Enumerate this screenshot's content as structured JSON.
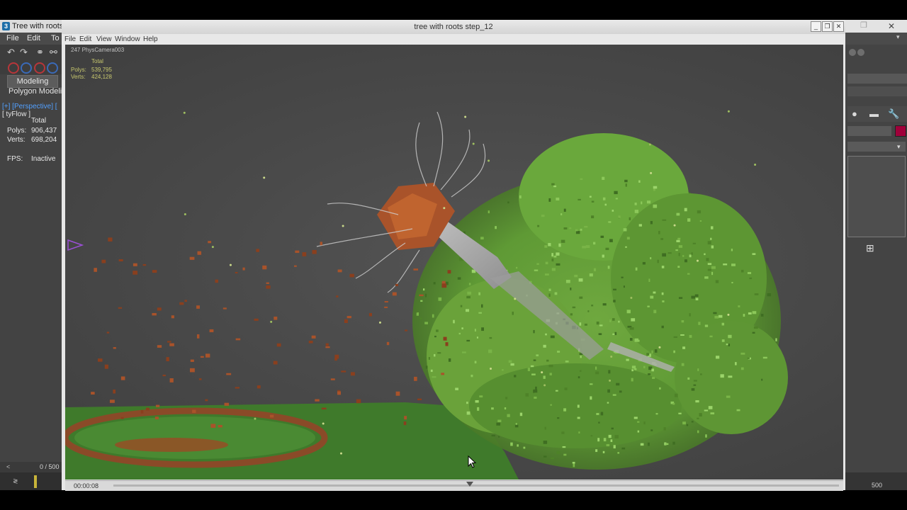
{
  "bg_window": {
    "title": "Tree with roots",
    "menu": [
      "File",
      "Edit",
      "To"
    ],
    "ribbon_tab": "Modeling",
    "ribbon_sub": "Polygon Modelin",
    "viewport_label": "[+] [Perspective] [",
    "viewport_sub": "[ tyFlow ]",
    "stats_total": "Total",
    "stats_polys_label": "Polys:",
    "stats_polys": "906,437",
    "stats_verts_label": "Verts:",
    "stats_verts": "698,204",
    "fps_label": "FPS:",
    "fps_value": "Inactive",
    "time_counter": "0 / 500",
    "right_timeline_end": "500"
  },
  "render_window": {
    "title": "tree with roots step_12",
    "menu": [
      "File",
      "Edit",
      "View",
      "Window",
      "Help"
    ],
    "camera_label": "247  PhysCamera003",
    "stats_total": "Total",
    "stats_polys_label": "Polys:",
    "stats_polys": "539,795",
    "stats_verts_label": "Verts:",
    "stats_verts": "424,128",
    "timecode": "00:00:08",
    "playhead_fraction": 0.47
  },
  "colors": {
    "viewport_bg": "#4a4a4a",
    "leaf_green": "#7ab648",
    "root_orange": "#b8582a",
    "ground_green": "#3d7a2a",
    "accent_blue": "#52a0ff",
    "stats_yellow": "#c8c86e"
  }
}
